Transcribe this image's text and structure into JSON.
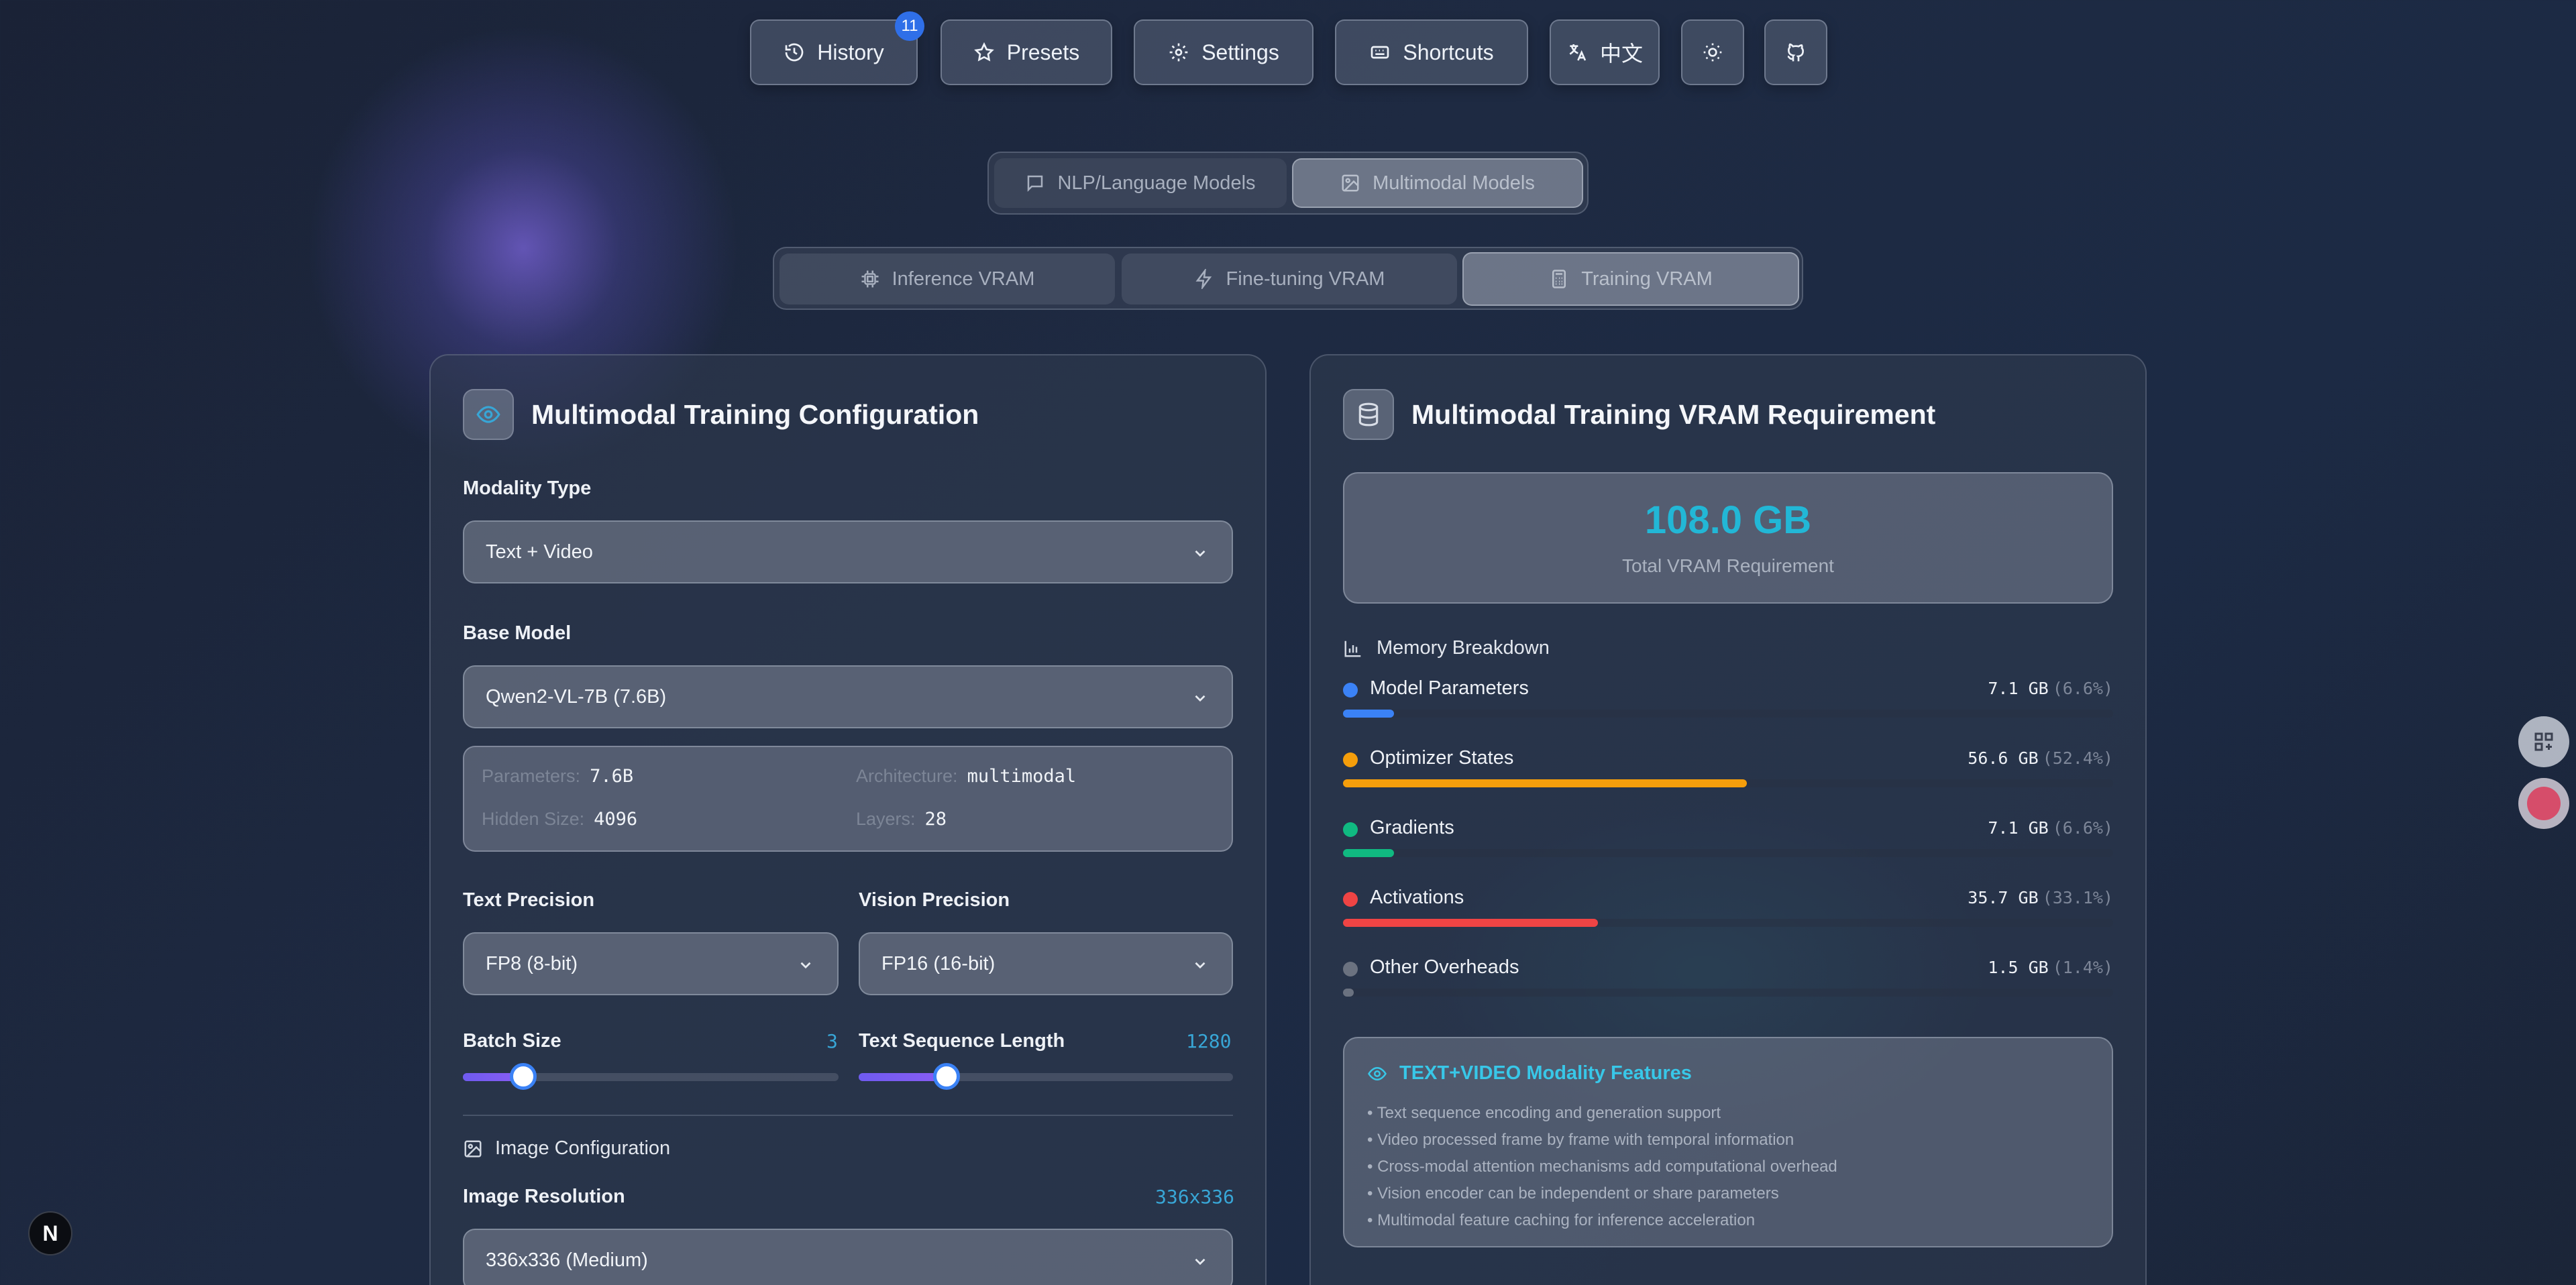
{
  "nav": {
    "history_label": "History",
    "history_badge": "11",
    "presets_label": "Presets",
    "settings_label": "Settings",
    "shortcuts_label": "Shortcuts",
    "language_label": "中文"
  },
  "model_category_tabs": [
    {
      "label": "NLP/Language Models",
      "active": false
    },
    {
      "label": "Multimodal Models",
      "active": true
    }
  ],
  "mode_tabs": [
    {
      "label": "Inference VRAM",
      "active": false
    },
    {
      "label": "Fine-tuning VRAM",
      "active": false
    },
    {
      "label": "Training VRAM",
      "active": true
    }
  ],
  "config": {
    "title": "Multimodal Training Configuration",
    "modality_label": "Modality Type",
    "modality_value": "Text + Video",
    "base_model_label": "Base Model",
    "base_model_value": "Qwen2-VL-7B (7.6B)",
    "model_info": {
      "parameters_label": "Parameters:",
      "parameters_value": "7.6B",
      "architecture_label": "Architecture:",
      "architecture_value": "multimodal",
      "hidden_size_label": "Hidden Size:",
      "hidden_size_value": "4096",
      "layers_label": "Layers:",
      "layers_value": "28"
    },
    "text_precision_label": "Text Precision",
    "text_precision_value": "FP8 (8-bit)",
    "vision_precision_label": "Vision Precision",
    "vision_precision_value": "FP16 (16-bit)",
    "batch_size_label": "Batch Size",
    "batch_size_value": "3",
    "batch_size_fraction": 0.16,
    "seq_len_label": "Text Sequence Length",
    "seq_len_value": "1280",
    "seq_len_fraction": 0.235,
    "image_config_label": "Image Configuration",
    "image_resolution_label": "Image Resolution",
    "image_resolution_value": "336x336",
    "image_resolution_select": "336x336 (Medium)"
  },
  "result": {
    "title": "Multimodal Training VRAM Requirement",
    "total_value": "108.0 GB",
    "total_label": "Total VRAM Requirement",
    "breakdown_title": "Memory Breakdown",
    "items": [
      {
        "name": "Model Parameters",
        "amount": "7.1 GB",
        "pct": "(6.6%)",
        "fraction": 0.066,
        "color": "#3b82f6"
      },
      {
        "name": "Optimizer States",
        "amount": "56.6 GB",
        "pct": "(52.4%)",
        "fraction": 0.524,
        "color": "#f59e0b"
      },
      {
        "name": "Gradients",
        "amount": "7.1 GB",
        "pct": "(6.6%)",
        "fraction": 0.066,
        "color": "#10b981"
      },
      {
        "name": "Activations",
        "amount": "35.7 GB",
        "pct": "(33.1%)",
        "fraction": 0.331,
        "color": "#ef4444"
      },
      {
        "name": "Other Overheads",
        "amount": "1.5 GB",
        "pct": "(1.4%)",
        "fraction": 0.014,
        "color": "#6b7280"
      }
    ],
    "features_title": "TEXT+VIDEO Modality Features",
    "features": [
      "• Text sequence encoding and generation support",
      "• Video processed frame by frame with temporal information",
      "• Cross-modal attention mechanisms add computational overhead",
      "• Vision encoder can be independent or share parameters",
      "• Multimodal feature caching for inference acceleration"
    ]
  },
  "footer_logo": "N"
}
